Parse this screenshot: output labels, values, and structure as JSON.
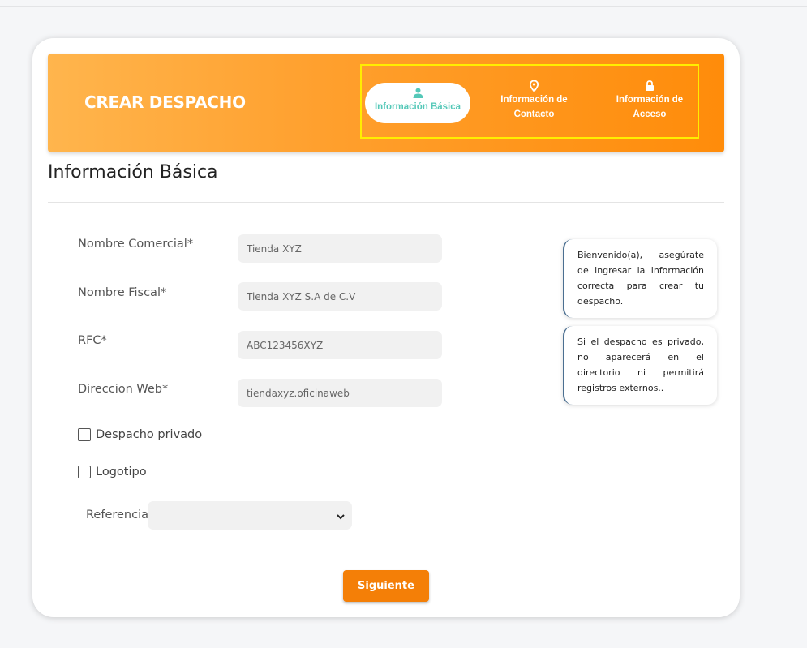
{
  "banner": {
    "title": "CREAR DESPACHO",
    "steps": [
      {
        "label": "Información Básica",
        "icon": "user-icon",
        "active": true
      },
      {
        "label_line1": "Información de",
        "label_line2": "Contacto",
        "icon": "location-pin-icon",
        "active": false
      },
      {
        "label_line1": "Información de",
        "label_line2": "Acceso",
        "icon": "lock-icon",
        "active": false
      }
    ]
  },
  "section": {
    "title": "Información Básica"
  },
  "form": {
    "nombre_comercial": {
      "label": "Nombre Comercial*",
      "placeholder": "Tienda XYZ"
    },
    "nombre_fiscal": {
      "label": "Nombre Fiscal*",
      "placeholder": "Tienda XYZ S.A de C.V"
    },
    "rfc": {
      "label": "RFC*",
      "placeholder": "ABC123456XYZ"
    },
    "direccion_web": {
      "label": "Direccion Web*",
      "placeholder": "tiendaxyz.oficinaweb"
    },
    "despacho_privado": {
      "label": "Despacho privado",
      "checked": false
    },
    "logotipo": {
      "label": "Logotipo",
      "checked": false
    },
    "referencia": {
      "label": "Referencia",
      "value": ""
    },
    "submit_label": "Siguiente"
  },
  "notes": [
    "Bienvenido(a), asegúrate de ingresar la información correcta para crear tu despacho.",
    "Si el despacho es privado, no aparecerá en el directorio ni permitirá registros externos.."
  ],
  "colors": {
    "accent": "#f47f07",
    "active_step_text": "#55c8b8",
    "highlight_border": "#ffee00",
    "note_border": "#4b6f91"
  }
}
